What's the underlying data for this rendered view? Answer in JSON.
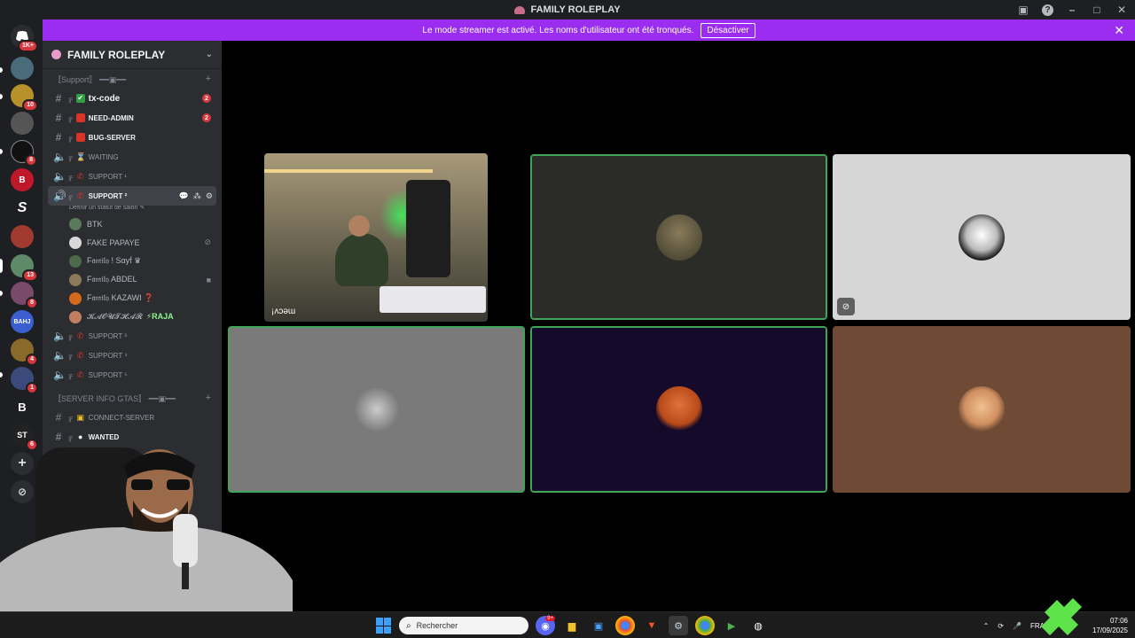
{
  "window": {
    "title": "FAMILY ROLEPLAY"
  },
  "titlebar_icons": [
    "inbox-icon",
    "help-icon",
    "minimize-icon",
    "maximize-icon",
    "close-icon"
  ],
  "banner": {
    "text": "Le mode streamer est activé. Les noms d'utilisateur ont été tronqués.",
    "button": "Désactiver"
  },
  "rail": {
    "home_badge": "1K+",
    "servers": [
      {
        "name": "server-1",
        "badge": ""
      },
      {
        "name": "server-2",
        "badge": "10"
      },
      {
        "name": "server-3",
        "badge": ""
      },
      {
        "name": "server-4",
        "badge": "8"
      },
      {
        "name": "server-5",
        "badge": ""
      },
      {
        "name": "server-6",
        "badge": ""
      },
      {
        "name": "server-7",
        "badge": ""
      },
      {
        "name": "server-8",
        "badge": "13"
      },
      {
        "name": "server-9",
        "badge": "8"
      },
      {
        "name": "BAHJ",
        "badge": ""
      },
      {
        "name": "server-11",
        "badge": "4"
      },
      {
        "name": "server-12",
        "badge": "1"
      },
      {
        "name": "server-13",
        "badge": ""
      },
      {
        "name": "server-14",
        "badge": "6"
      }
    ],
    "bahj_label": "BAHJ"
  },
  "sidebar": {
    "server_name": "FAMILY ROLEPLAY",
    "category_support": "〚Support〛 ━━▣━━",
    "channels_support": [
      {
        "label": "tx-code",
        "badge": "2",
        "type": "text"
      },
      {
        "label": "NEED-ADMIN",
        "badge": "2",
        "type": "text"
      },
      {
        "label": "BUG-SERVER",
        "badge": "",
        "type": "text"
      },
      {
        "label": "WAITING",
        "badge": "",
        "type": "voice"
      },
      {
        "label": "SUPPORT ¹",
        "badge": "",
        "type": "voice"
      },
      {
        "label": "SUPPORT ²",
        "badge": "",
        "type": "voice"
      }
    ],
    "status_hint": "Définir un statut de salon",
    "voice_users": [
      {
        "name": "BTK"
      },
      {
        "name": "FAKE PAPAYE"
      },
      {
        "name": "F𝔞𝔪𝔦𝔩𝔶 ! Sαyḟ ♛"
      },
      {
        "name": "F𝔞𝔪𝔦𝔩𝔶 ABDEL"
      },
      {
        "name": "F𝔞𝔪𝔦𝔩𝔶 KAZAWI ❓"
      },
      {
        "name": "𝓚𝓐𝓞𝓤𝓣𝓗𝓐𝓡",
        "extra": "⚡RAJA"
      }
    ],
    "channels_support_more": [
      {
        "label": "SUPPORT ³"
      },
      {
        "label": "SUPPORT ⁴"
      },
      {
        "label": "SUPPORT ⁵"
      }
    ],
    "category_info": "〚SERVER INFO GTAS〛 ━━▣━━",
    "channels_info": [
      {
        "label": "CONNECT-SERVER"
      },
      {
        "label": "WANTED"
      }
    ]
  },
  "tiles": {
    "camera_tag": "¡ʌɔǝɯ"
  },
  "taskbar": {
    "search_placeholder": "Rechercher",
    "discord_badge": "9+",
    "language": "FRA",
    "time": "07:06",
    "date": "17/09/2025"
  }
}
